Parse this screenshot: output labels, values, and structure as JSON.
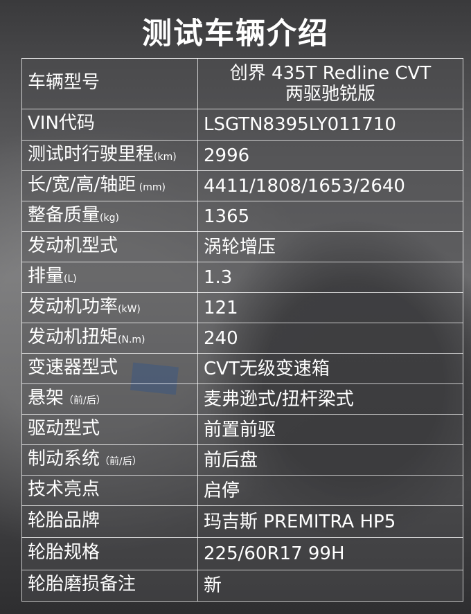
{
  "title": "测试车辆介绍",
  "rows": [
    {
      "label": "车辆型号",
      "unit": "",
      "value": "创界 435T Redline CVT\n两驱驰锐版"
    },
    {
      "label": "VIN代码",
      "unit": "",
      "value": "LSGTN8395LY011710"
    },
    {
      "label": "测试时行驶里程",
      "unit": "(km)",
      "value": "2996"
    },
    {
      "label": "长/宽/高/轴距",
      "unit": " (mm)",
      "value": "4411/1808/1653/2640"
    },
    {
      "label": "整备质量",
      "unit": "(kg)",
      "value": "1365"
    },
    {
      "label": "发动机型式",
      "unit": "",
      "value": "涡轮增压"
    },
    {
      "label": "排量",
      "unit": "(L)",
      "value": "1.3"
    },
    {
      "label": "发动机功率",
      "unit": "(kW)",
      "value": "121"
    },
    {
      "label": "发动机扭矩",
      "unit": "(N.m)",
      "value": "240"
    },
    {
      "label": "变速器型式",
      "unit": "",
      "value": "CVT无级变速箱"
    },
    {
      "label": "悬架",
      "unit": "（前/后）",
      "value": "麦弗逊式/扭杆梁式"
    },
    {
      "label": "驱动型式",
      "unit": "",
      "value": "前置前驱"
    },
    {
      "label": "制动系统",
      "unit": "（前/后）",
      "value": "前后盘"
    },
    {
      "label": "技术亮点",
      "unit": "",
      "value": "启停"
    },
    {
      "label": "轮胎品牌",
      "unit": "",
      "value": "玛吉斯 PREMITRA HP5"
    },
    {
      "label": "轮胎规格",
      "unit": "",
      "value": "225/60R17 99H"
    },
    {
      "label": "轮胎磨损备注",
      "unit": "",
      "value": "新"
    }
  ]
}
